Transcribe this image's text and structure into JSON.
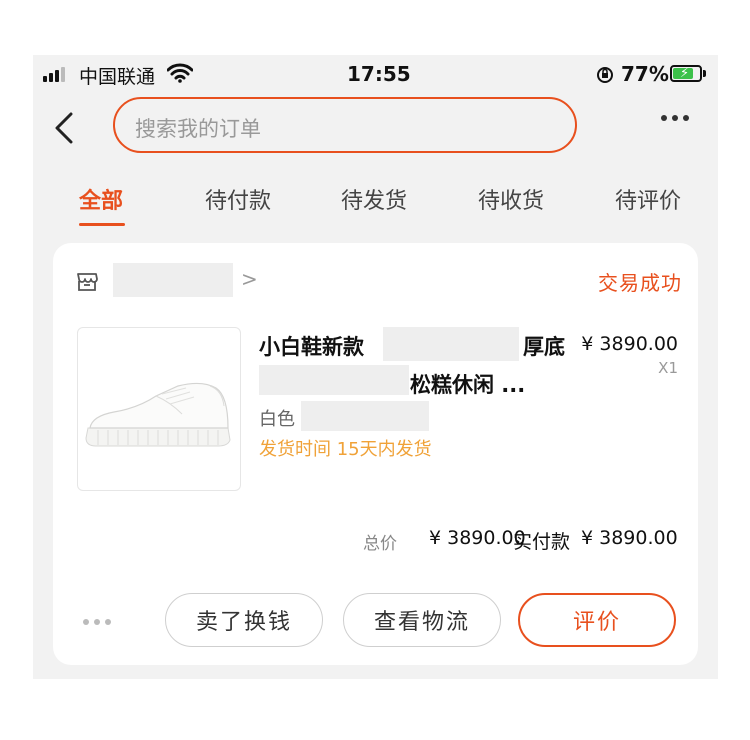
{
  "status_bar": {
    "carrier": "中国联通",
    "time": "17:55",
    "battery_percent": "77%",
    "battery_level": 0.77,
    "battery_charging": true
  },
  "header": {
    "search_placeholder": "搜索我的订单",
    "back_icon": "chevron-left-icon",
    "more_icon": "more-dots-icon"
  },
  "tabs": [
    {
      "label": "全部",
      "active": true
    },
    {
      "label": "待付款",
      "active": false
    },
    {
      "label": "待发货",
      "active": false
    },
    {
      "label": "待收货",
      "active": false
    },
    {
      "label": "待评价",
      "active": false
    }
  ],
  "order": {
    "shop_icon": "store-icon",
    "shop_chevron": ">",
    "status": "交易成功",
    "product": {
      "title_part1": "小白鞋新款",
      "title_part2": "厚底",
      "title_line2": "松糕休闲 ...",
      "price": "¥ 3890.00",
      "quantity": "X1",
      "spec": "白色",
      "shipping": "发货时间 15天内发货"
    },
    "total_label": "总价",
    "total_value": "¥ 3890.00",
    "paid_label": "实付款",
    "paid_value": "¥ 3890.00",
    "actions": {
      "sell": "卖了换钱",
      "logistics": "查看物流",
      "review": "评价"
    }
  },
  "colors": {
    "accent": "#e8501e",
    "shipping": "#f0a238",
    "background": "#f2f2f2"
  }
}
